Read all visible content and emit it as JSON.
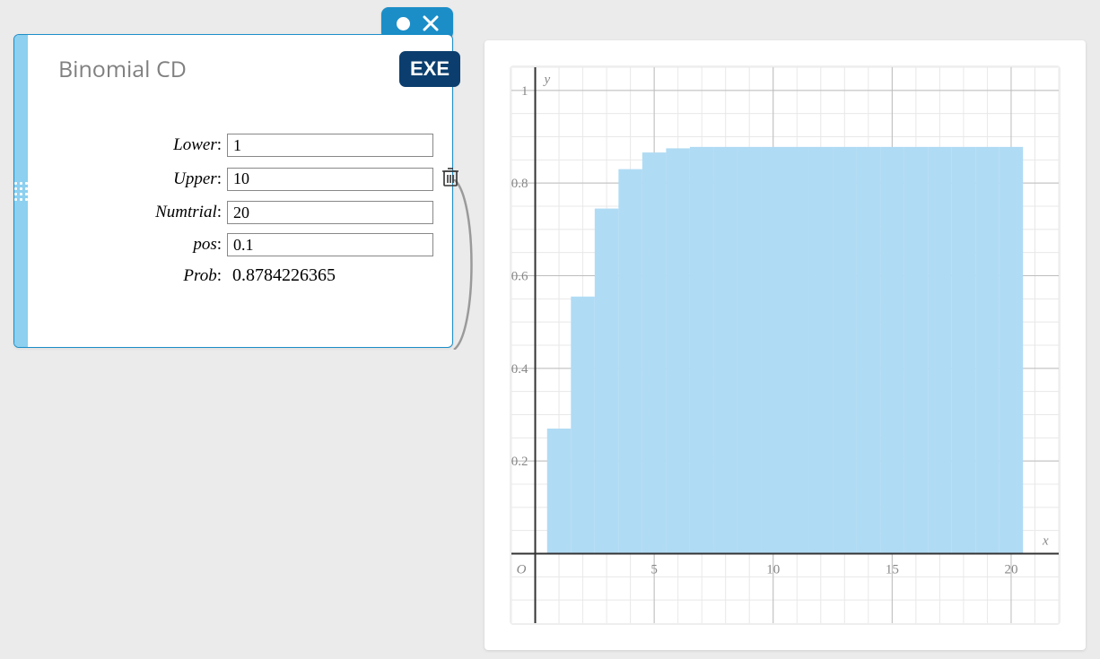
{
  "panel": {
    "title": "Binomial CD",
    "exe_label": "EXE",
    "fields": {
      "lower": {
        "label": "Lower",
        "value": "1"
      },
      "upper": {
        "label": "Upper",
        "value": "10"
      },
      "numtrial": {
        "label": "Numtrial",
        "value": "20"
      },
      "pos": {
        "label": "pos",
        "value": "0.1"
      },
      "prob": {
        "label": "Prob",
        "value": "0.8784226365"
      }
    }
  },
  "chart_data": {
    "type": "bar",
    "title": "",
    "xlabel": "x",
    "ylabel": "y",
    "origin_label": "O",
    "xlim": [
      -1,
      22
    ],
    "ylim": [
      -0.15,
      1.05
    ],
    "x_ticks": [
      5,
      10,
      15,
      20
    ],
    "y_ticks": [
      0.2,
      0.4,
      0.6,
      0.8,
      1
    ],
    "categories": [
      1,
      2,
      3,
      4,
      5,
      6,
      7,
      8,
      9,
      10,
      11,
      12,
      13,
      14,
      15,
      16,
      17,
      18,
      19,
      20
    ],
    "values": [
      0.27,
      0.555,
      0.745,
      0.83,
      0.866,
      0.875,
      0.878,
      0.878,
      0.878,
      0.878,
      0.878,
      0.878,
      0.878,
      0.878,
      0.878,
      0.878,
      0.878,
      0.878,
      0.878,
      0.878
    ],
    "bar_color": "#b0dbf4",
    "grid_minor": "#e8e8e8",
    "grid_major": "#bcbcbc",
    "axis_color": "#333333"
  }
}
